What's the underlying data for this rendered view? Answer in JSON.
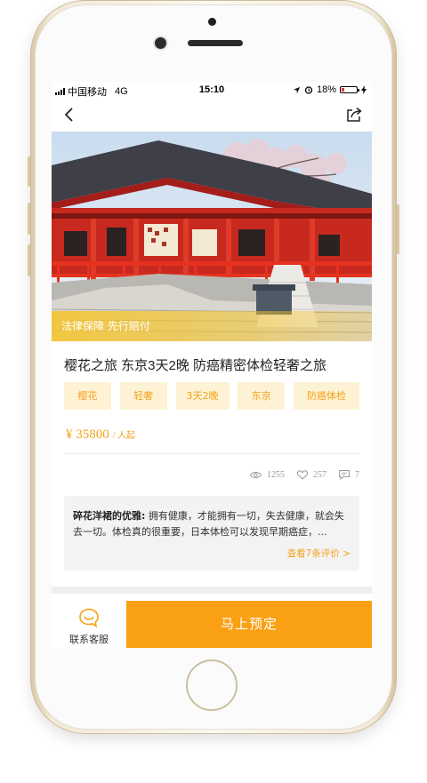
{
  "status": {
    "carrier": "中国移动",
    "network": "4G",
    "time": "15:10",
    "battery": "18%",
    "battery_level": 0.18
  },
  "hero": {
    "badge": "法律保障 先行赔付"
  },
  "product": {
    "title": "樱花之旅 东京3天2晚 防癌精密体检轻奢之旅",
    "tags": [
      "樱花",
      "轻奢",
      "3天2晚",
      "东京",
      "防癌体检"
    ],
    "price_amount": "¥ 35800",
    "price_unit": "/ 人起"
  },
  "stats": {
    "views": "1255",
    "likes": "257",
    "comments": "7"
  },
  "review": {
    "author": "碎花洋裙的优雅:",
    "text": " 拥有健康，才能拥有一切，失去健康，就会失去一切。体检真的很重要，日本体检可以发现早期癌症，...",
    "more_link": "查看7条评价 >"
  },
  "bottom": {
    "service_label": "联系客服",
    "book_label": "马上预定"
  },
  "colors": {
    "accent": "#f9a013",
    "tag_bg": "#fdf2d4",
    "tag_text": "#f5a21b"
  }
}
